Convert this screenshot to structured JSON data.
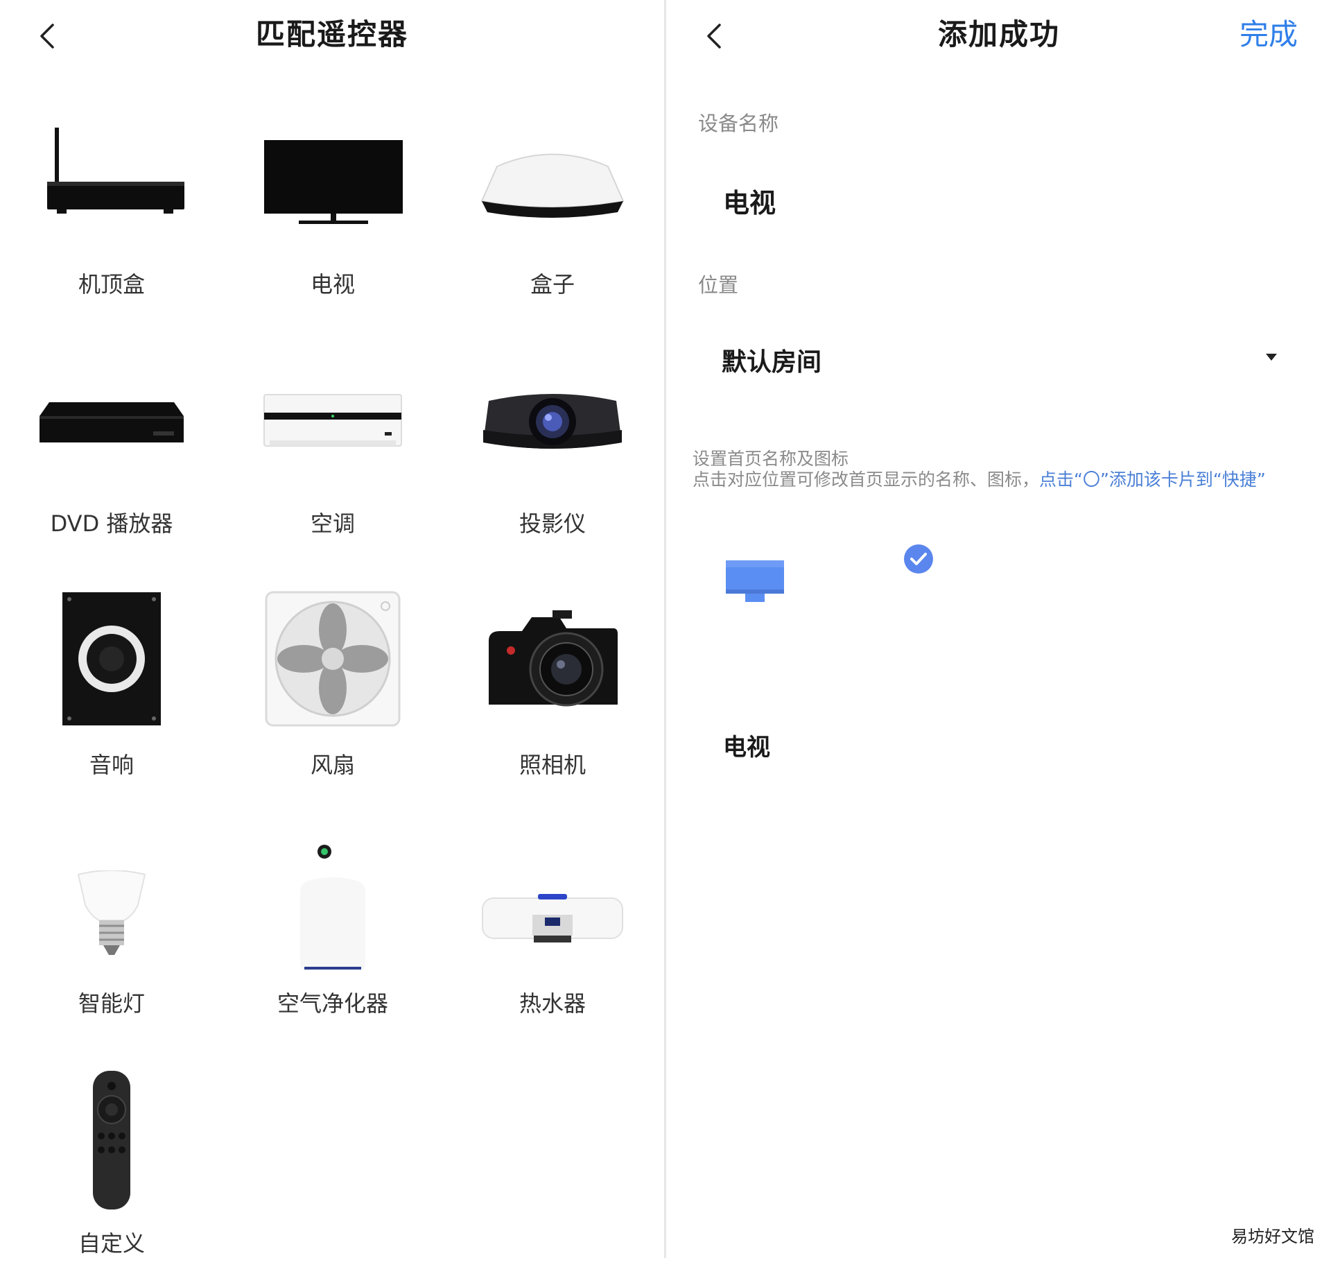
{
  "left": {
    "title": "匹配遥控器",
    "devices": [
      {
        "label": "机顶盒",
        "icon": "set-top-box-icon"
      },
      {
        "label": "电视",
        "icon": "tv-icon"
      },
      {
        "label": "盒子",
        "icon": "media-box-icon"
      },
      {
        "label": "DVD 播放器",
        "icon": "dvd-player-icon"
      },
      {
        "label": "空调",
        "icon": "air-conditioner-icon"
      },
      {
        "label": "投影仪",
        "icon": "projector-icon"
      },
      {
        "label": "音响",
        "icon": "speaker-icon"
      },
      {
        "label": "风扇",
        "icon": "fan-icon"
      },
      {
        "label": "照相机",
        "icon": "camera-icon"
      },
      {
        "label": "智能灯",
        "icon": "smart-bulb-icon"
      },
      {
        "label": "空气净化器",
        "icon": "air-purifier-icon"
      },
      {
        "label": "热水器",
        "icon": "water-heater-icon"
      },
      {
        "label": "自定义",
        "icon": "remote-control-icon"
      }
    ]
  },
  "right": {
    "title": "添加成功",
    "done_label": "完成",
    "device_name_label": "设备名称",
    "device_name_value": "电视",
    "location_label": "位置",
    "location_value": "默认房间",
    "info_line1": "设置首页名称及图标",
    "info_line2_prefix": "点击对应位置可修改首页显示的名称、图标，",
    "info_line2_link": "点击“〇”添加该卡片到“快捷”",
    "card_name": "电视",
    "accent_color": "#2f7fe9",
    "card_icon_color": "#5b8ef2"
  },
  "watermark": "易坊好文馆"
}
